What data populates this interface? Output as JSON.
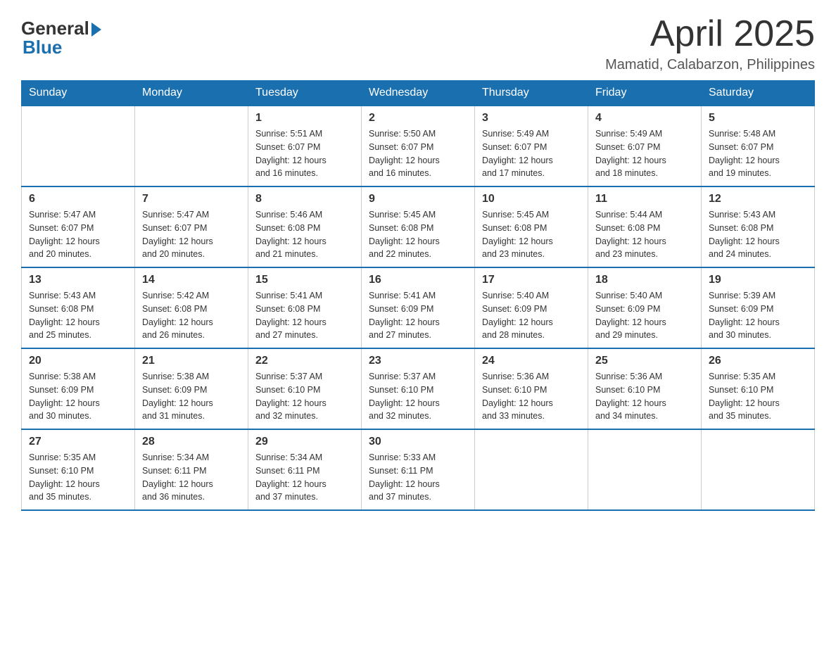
{
  "header": {
    "logo_general": "General",
    "logo_blue": "Blue",
    "month_title": "April 2025",
    "location": "Mamatid, Calabarzon, Philippines"
  },
  "days_of_week": [
    "Sunday",
    "Monday",
    "Tuesday",
    "Wednesday",
    "Thursday",
    "Friday",
    "Saturday"
  ],
  "weeks": [
    [
      {
        "day": "",
        "info": ""
      },
      {
        "day": "",
        "info": ""
      },
      {
        "day": "1",
        "info": "Sunrise: 5:51 AM\nSunset: 6:07 PM\nDaylight: 12 hours\nand 16 minutes."
      },
      {
        "day": "2",
        "info": "Sunrise: 5:50 AM\nSunset: 6:07 PM\nDaylight: 12 hours\nand 16 minutes."
      },
      {
        "day": "3",
        "info": "Sunrise: 5:49 AM\nSunset: 6:07 PM\nDaylight: 12 hours\nand 17 minutes."
      },
      {
        "day": "4",
        "info": "Sunrise: 5:49 AM\nSunset: 6:07 PM\nDaylight: 12 hours\nand 18 minutes."
      },
      {
        "day": "5",
        "info": "Sunrise: 5:48 AM\nSunset: 6:07 PM\nDaylight: 12 hours\nand 19 minutes."
      }
    ],
    [
      {
        "day": "6",
        "info": "Sunrise: 5:47 AM\nSunset: 6:07 PM\nDaylight: 12 hours\nand 20 minutes."
      },
      {
        "day": "7",
        "info": "Sunrise: 5:47 AM\nSunset: 6:07 PM\nDaylight: 12 hours\nand 20 minutes."
      },
      {
        "day": "8",
        "info": "Sunrise: 5:46 AM\nSunset: 6:08 PM\nDaylight: 12 hours\nand 21 minutes."
      },
      {
        "day": "9",
        "info": "Sunrise: 5:45 AM\nSunset: 6:08 PM\nDaylight: 12 hours\nand 22 minutes."
      },
      {
        "day": "10",
        "info": "Sunrise: 5:45 AM\nSunset: 6:08 PM\nDaylight: 12 hours\nand 23 minutes."
      },
      {
        "day": "11",
        "info": "Sunrise: 5:44 AM\nSunset: 6:08 PM\nDaylight: 12 hours\nand 23 minutes."
      },
      {
        "day": "12",
        "info": "Sunrise: 5:43 AM\nSunset: 6:08 PM\nDaylight: 12 hours\nand 24 minutes."
      }
    ],
    [
      {
        "day": "13",
        "info": "Sunrise: 5:43 AM\nSunset: 6:08 PM\nDaylight: 12 hours\nand 25 minutes."
      },
      {
        "day": "14",
        "info": "Sunrise: 5:42 AM\nSunset: 6:08 PM\nDaylight: 12 hours\nand 26 minutes."
      },
      {
        "day": "15",
        "info": "Sunrise: 5:41 AM\nSunset: 6:08 PM\nDaylight: 12 hours\nand 27 minutes."
      },
      {
        "day": "16",
        "info": "Sunrise: 5:41 AM\nSunset: 6:09 PM\nDaylight: 12 hours\nand 27 minutes."
      },
      {
        "day": "17",
        "info": "Sunrise: 5:40 AM\nSunset: 6:09 PM\nDaylight: 12 hours\nand 28 minutes."
      },
      {
        "day": "18",
        "info": "Sunrise: 5:40 AM\nSunset: 6:09 PM\nDaylight: 12 hours\nand 29 minutes."
      },
      {
        "day": "19",
        "info": "Sunrise: 5:39 AM\nSunset: 6:09 PM\nDaylight: 12 hours\nand 30 minutes."
      }
    ],
    [
      {
        "day": "20",
        "info": "Sunrise: 5:38 AM\nSunset: 6:09 PM\nDaylight: 12 hours\nand 30 minutes."
      },
      {
        "day": "21",
        "info": "Sunrise: 5:38 AM\nSunset: 6:09 PM\nDaylight: 12 hours\nand 31 minutes."
      },
      {
        "day": "22",
        "info": "Sunrise: 5:37 AM\nSunset: 6:10 PM\nDaylight: 12 hours\nand 32 minutes."
      },
      {
        "day": "23",
        "info": "Sunrise: 5:37 AM\nSunset: 6:10 PM\nDaylight: 12 hours\nand 32 minutes."
      },
      {
        "day": "24",
        "info": "Sunrise: 5:36 AM\nSunset: 6:10 PM\nDaylight: 12 hours\nand 33 minutes."
      },
      {
        "day": "25",
        "info": "Sunrise: 5:36 AM\nSunset: 6:10 PM\nDaylight: 12 hours\nand 34 minutes."
      },
      {
        "day": "26",
        "info": "Sunrise: 5:35 AM\nSunset: 6:10 PM\nDaylight: 12 hours\nand 35 minutes."
      }
    ],
    [
      {
        "day": "27",
        "info": "Sunrise: 5:35 AM\nSunset: 6:10 PM\nDaylight: 12 hours\nand 35 minutes."
      },
      {
        "day": "28",
        "info": "Sunrise: 5:34 AM\nSunset: 6:11 PM\nDaylight: 12 hours\nand 36 minutes."
      },
      {
        "day": "29",
        "info": "Sunrise: 5:34 AM\nSunset: 6:11 PM\nDaylight: 12 hours\nand 37 minutes."
      },
      {
        "day": "30",
        "info": "Sunrise: 5:33 AM\nSunset: 6:11 PM\nDaylight: 12 hours\nand 37 minutes."
      },
      {
        "day": "",
        "info": ""
      },
      {
        "day": "",
        "info": ""
      },
      {
        "day": "",
        "info": ""
      }
    ]
  ]
}
